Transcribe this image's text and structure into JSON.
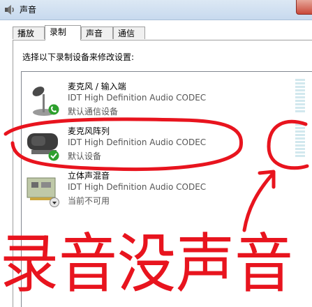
{
  "window": {
    "title": "声音"
  },
  "tabs": [
    {
      "label": "播放"
    },
    {
      "label": "录制"
    },
    {
      "label": "声音"
    },
    {
      "label": "通信"
    }
  ],
  "instruction": "选择以下录制设备来修改设置:",
  "devices": [
    {
      "name": "麦克风 / 输入端",
      "description": "IDT High Definition Audio CODEC",
      "status": "默认通信设备",
      "icon": "microphone-icon",
      "badge": "phone-badge-icon"
    },
    {
      "name": "麦克风阵列",
      "description": "IDT High Definition Audio CODEC",
      "status": "默认设备",
      "icon": "webcam-microphone-icon",
      "badge": "check-badge-icon"
    },
    {
      "name": "立体声混音",
      "description": "IDT High Definition Audio CODEC",
      "status": "当前不可用",
      "icon": "sound-card-icon",
      "badge": "down-arrow-badge-icon"
    }
  ],
  "annotation": {
    "handwritten_text": "录音没声音",
    "color": "#e8141e"
  },
  "colors": {
    "accent_green": "#2da02d",
    "meter": "#d2e8ee"
  }
}
